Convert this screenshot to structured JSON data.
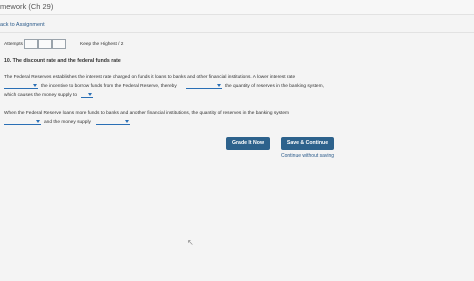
{
  "header": {
    "app_title": "mework (Ch 29)",
    "back_link": "ack to Assignment"
  },
  "attempts": {
    "label": "Attempts",
    "keep_highest": "Keep the Highest / 2"
  },
  "question": {
    "title": "10. The discount rate and the federal funds rate",
    "p1_line1": "The Federal Reserves establishes the interest rate charged on funds it loans to banks and other financial institutions. A lower interest rate",
    "p1_seg_a": "the incentive to borrow funds from the Federal Reserve, thereby",
    "p1_seg_b": "the quantity of reserves in the banking system,",
    "p1_line3": "which causes the money supply to",
    "p2_line1": "When the Federal Reserve loans more funds to banks and another financial institutions, the quantity of reserves in the banking system",
    "p2_seg_a": "and the money supply"
  },
  "actions": {
    "grade_label": "Grade It Now",
    "save_label": "Save & Continue",
    "continue_link": "Continue without saving"
  }
}
